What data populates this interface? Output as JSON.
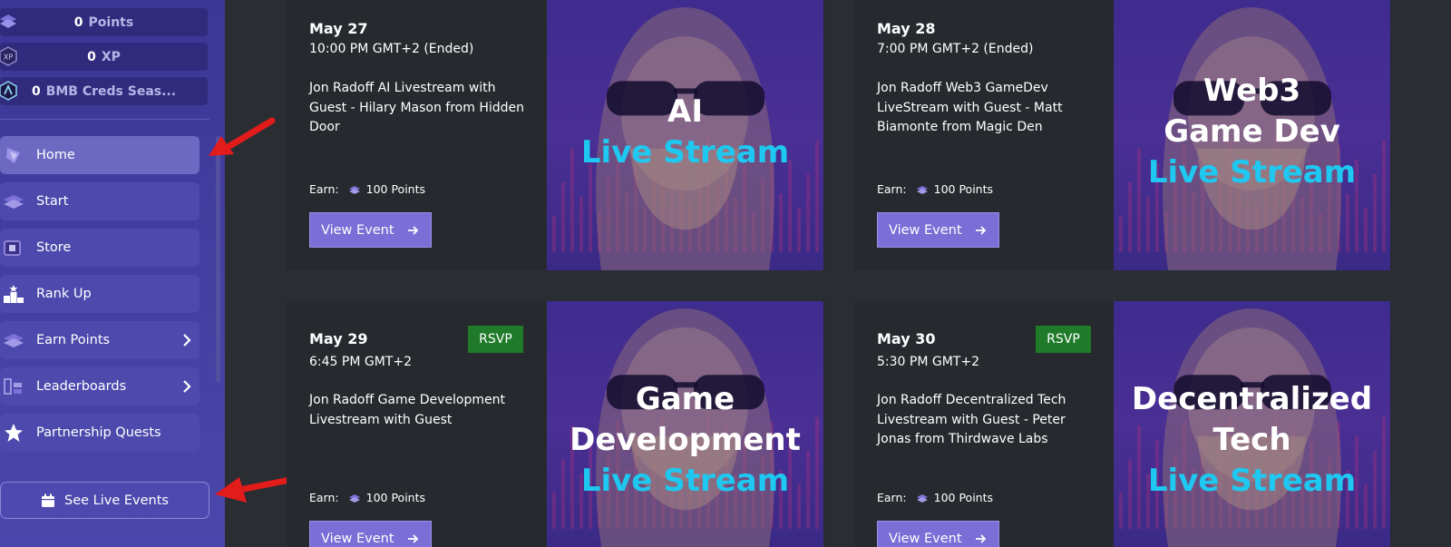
{
  "sidebar": {
    "stats": [
      {
        "value": "0",
        "unit": "Points",
        "icon": "points-icon"
      },
      {
        "value": "0",
        "unit": "XP",
        "icon": "xp-icon"
      },
      {
        "value": "0",
        "unit": "BMB Creds Seas...",
        "icon": "creds-icon"
      }
    ],
    "nav": [
      {
        "label": "Home",
        "icon": "home-icon",
        "active": true
      },
      {
        "label": "Start",
        "icon": "start-icon"
      },
      {
        "label": "Store",
        "icon": "store-icon"
      },
      {
        "label": "Rank Up",
        "icon": "podium-icon"
      },
      {
        "label": "Earn Points",
        "icon": "points-icon",
        "chevron": true
      },
      {
        "label": "Leaderboards",
        "icon": "leaderboard-icon",
        "chevron": true
      },
      {
        "label": "Partnership Quests",
        "icon": "star-icon"
      }
    ],
    "live_button": "See Live Events"
  },
  "events": [
    {
      "date": "May 27",
      "time": "10:00 PM GMT+2 (Ended)",
      "title": "Jon Radoff AI Livestream with Guest - Hilary Mason from Hidden Door",
      "earn_label": "Earn:",
      "earn_points": "100 Points",
      "button": "View Event",
      "thumb_lines": [
        "AI"
      ],
      "thumb_sub": "Live Stream"
    },
    {
      "date": "May 28",
      "time": "7:00 PM GMT+2 (Ended)",
      "title": "Jon Radoff Web3 GameDev LiveStream with Guest - Matt Biamonte from Magic Den",
      "earn_label": "Earn:",
      "earn_points": "100 Points",
      "button": "View Event",
      "thumb_lines": [
        "Web3",
        "Game Dev"
      ],
      "thumb_sub": "Live Stream"
    },
    {
      "date": "May 29",
      "time": "6:45 PM GMT+2",
      "title": "Jon Radoff Game Development Livestream with Guest",
      "rsvp": "RSVP",
      "earn_label": "Earn:",
      "earn_points": "100 Points",
      "button": "View Event",
      "thumb_lines": [
        "Game",
        "Development"
      ],
      "thumb_sub": "Live Stream"
    },
    {
      "date": "May 30",
      "time": "5:30 PM GMT+2",
      "title": "Jon Radoff Decentralized Tech Livestream with Guest - Peter Jonas from Thirdwave Labs",
      "rsvp": "RSVP",
      "earn_label": "Earn:",
      "earn_points": "100 Points",
      "button": "View Event",
      "thumb_lines": [
        "Decentralized",
        "Tech"
      ],
      "thumb_sub": "Live Stream"
    }
  ],
  "colors": {
    "sidebar": "#4541a3",
    "accent": "#7b6ed6",
    "rsvp": "#1f7a2a",
    "live_stream_text": "#1ec8f0",
    "annotation_arrow": "#e21b1b"
  }
}
